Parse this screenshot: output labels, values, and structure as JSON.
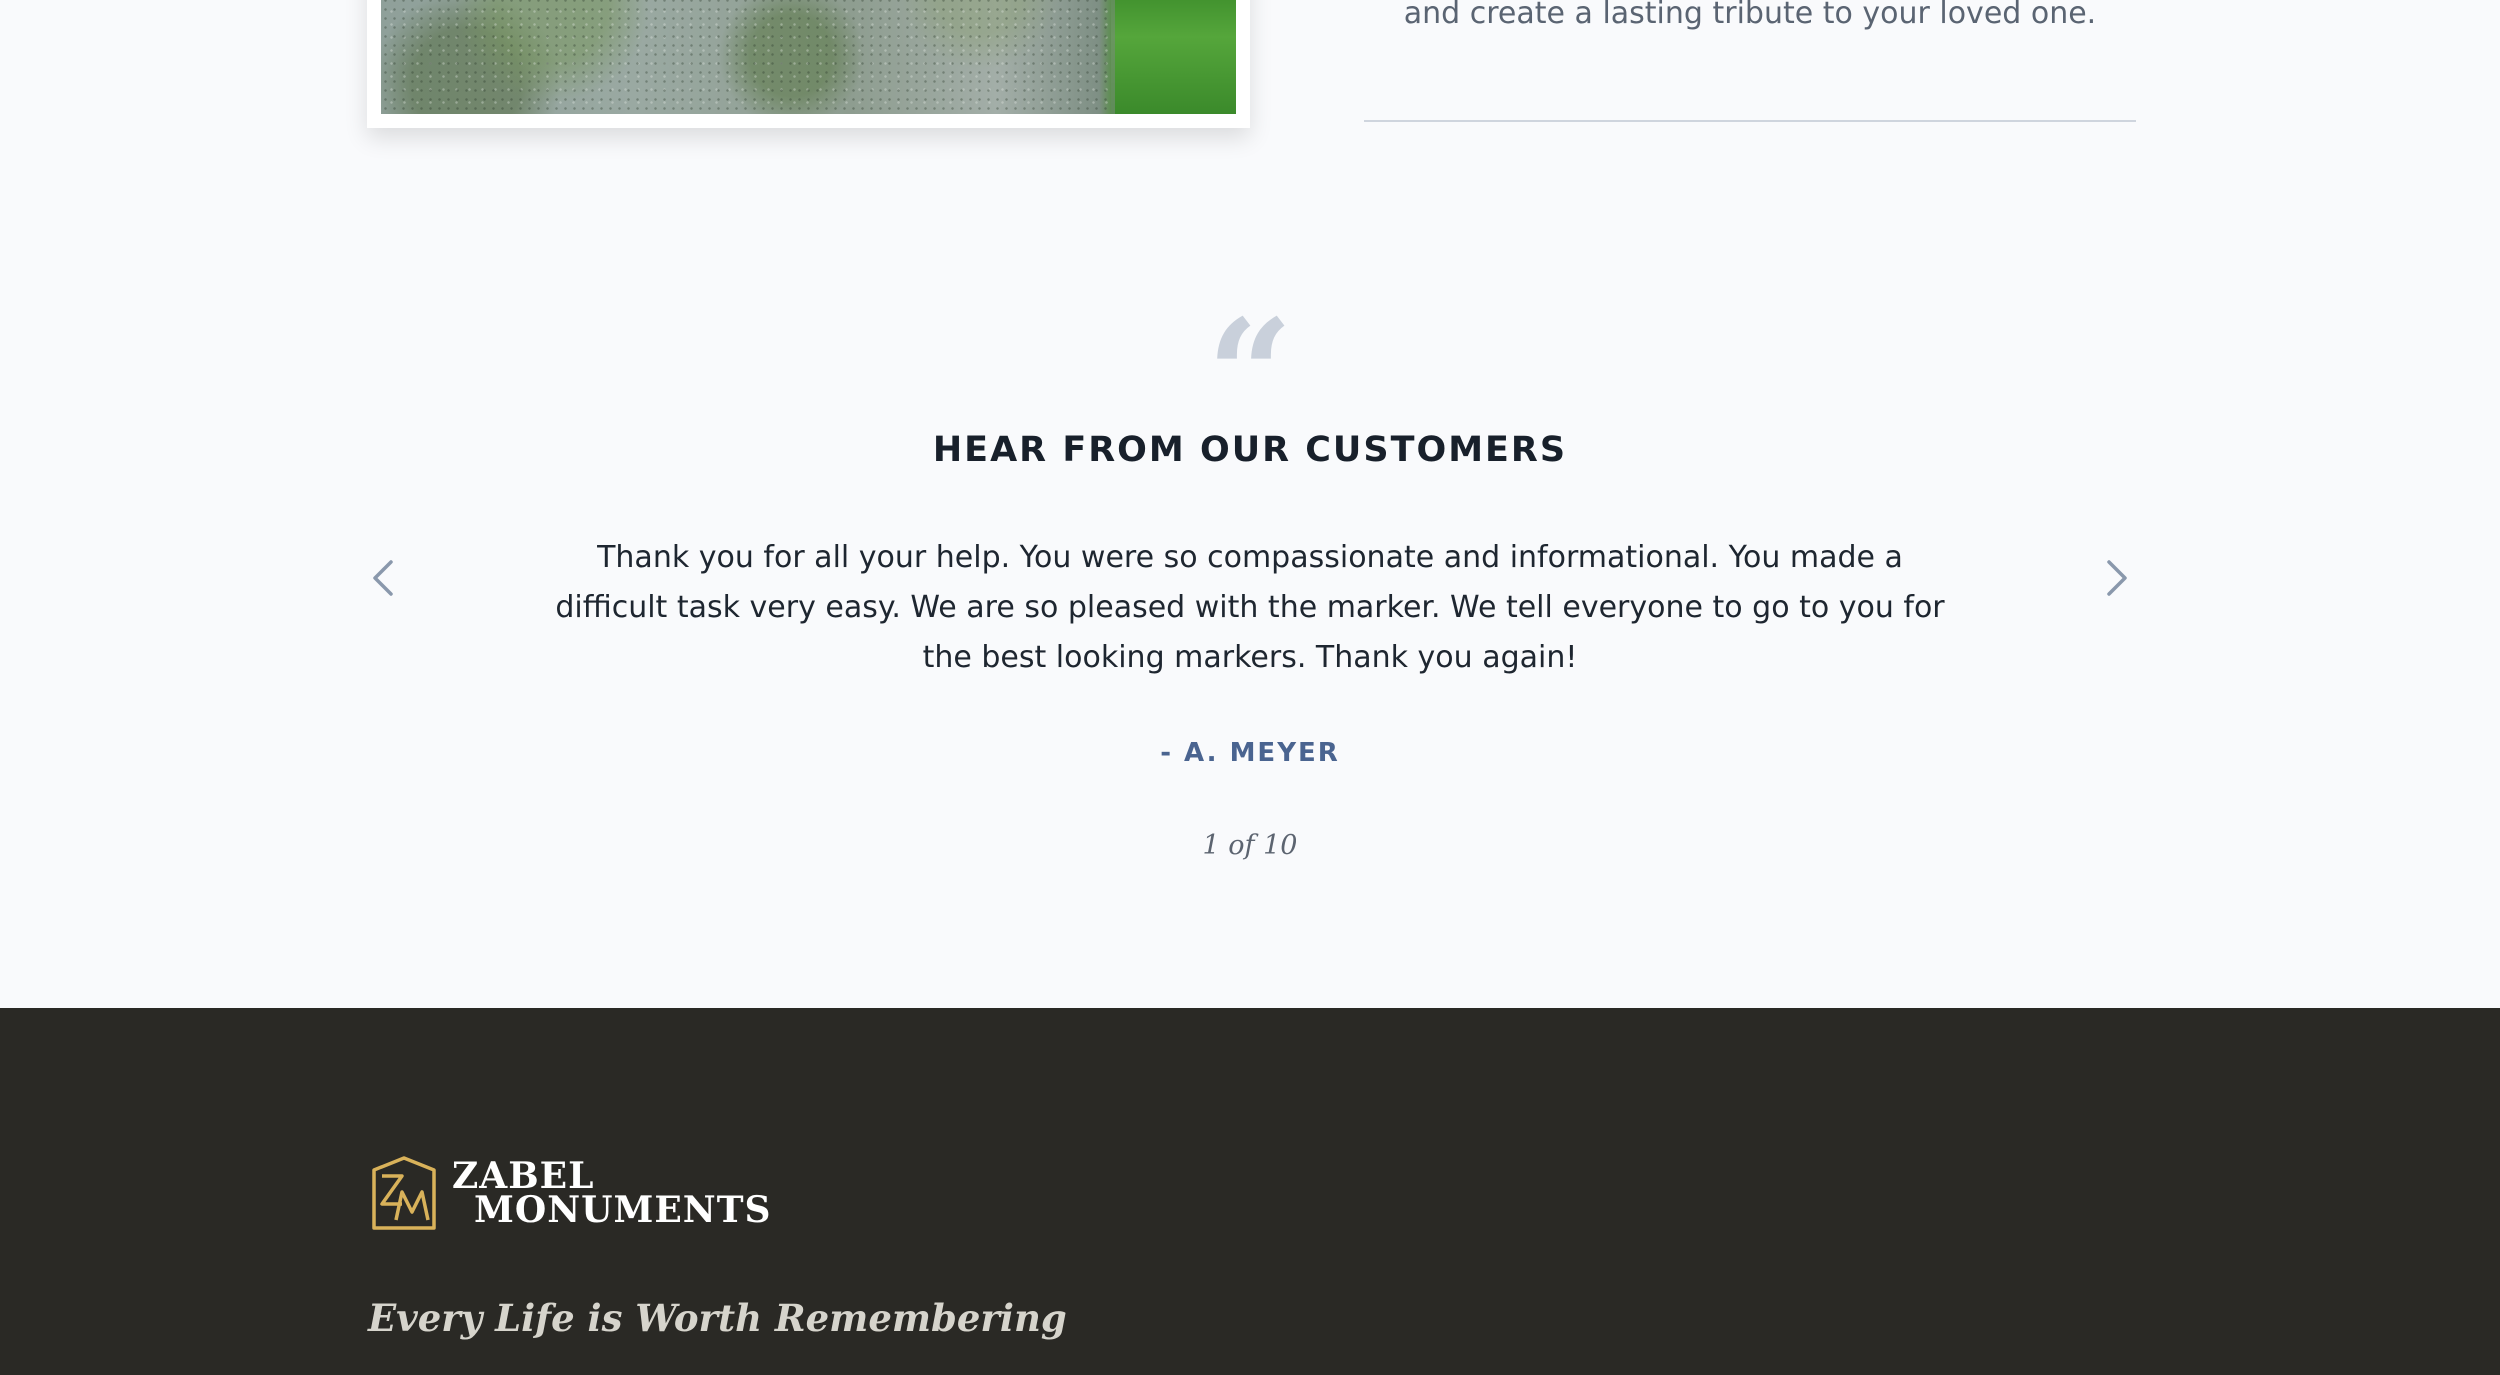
{
  "intro": {
    "text_tail": "and create a lasting tribute to your loved one."
  },
  "testimonials": {
    "title": "HEAR FROM OUR CUSTOMERS",
    "quote_icon": "quote-mark-icon",
    "quote": "Thank you for all your help. You were so compassionate and informational. You made a difficult task very easy. We are so pleased with the marker. We tell everyone to go to you for the best looking markers. Thank you again!",
    "author": "- A. MEYER",
    "counter": "1 of 10",
    "prev_icon": "chevron-left-icon",
    "next_icon": "chevron-right-icon"
  },
  "footer": {
    "logo_monogram": "ZM",
    "logo_line1": "ZABEL",
    "logo_line2": "MONUMENTS",
    "tagline": "Every Life is Worth Remembering"
  },
  "colors": {
    "page_bg": "#f9fafc",
    "footer_bg": "#2a2925",
    "accent_gold": "#d9b25a",
    "author_blue": "#4a6490"
  }
}
